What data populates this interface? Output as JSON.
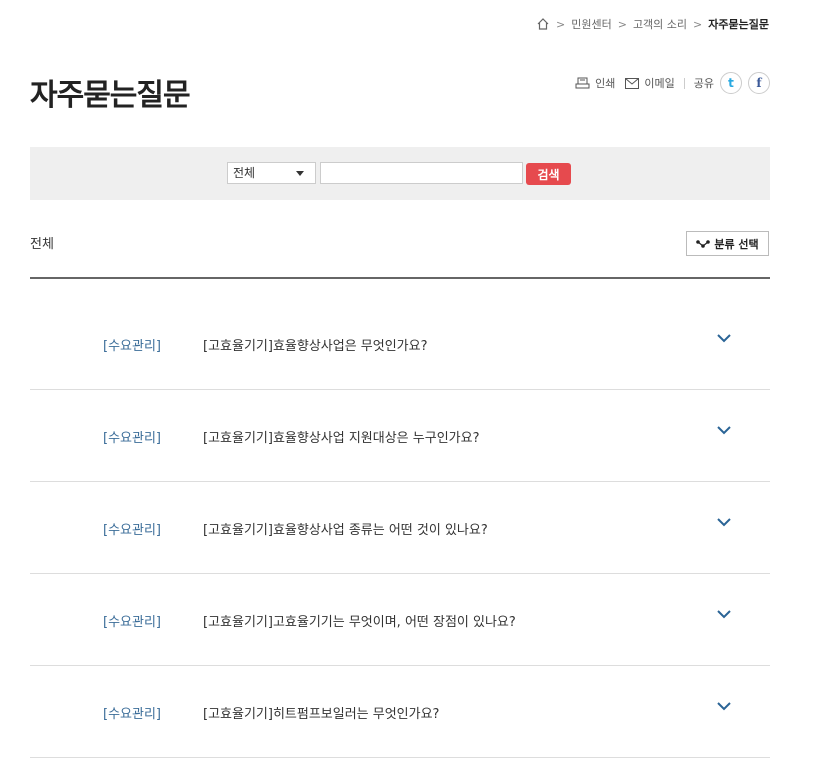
{
  "breadcrumb": {
    "items": [
      "민원센터",
      "고객의 소리"
    ],
    "current": "자주묻는질문"
  },
  "title": "자주묻는질문",
  "utils": {
    "print": "인쇄",
    "email": "이메일",
    "share": "공유",
    "twitter": "t",
    "facebook": "f"
  },
  "search": {
    "select_value": "전체",
    "input_value": "",
    "button": "검색"
  },
  "category": {
    "current": "전체",
    "select_button": "분류 선택"
  },
  "faq": [
    {
      "category": "[수요관리]",
      "question": "[고효율기기]효율향상사업은 무엇인가요?"
    },
    {
      "category": "[수요관리]",
      "question": "[고효율기기]효율향상사업 지원대상은 누구인가요?"
    },
    {
      "category": "[수요관리]",
      "question": "[고효율기기]효율향상사업 종류는 어떤 것이 있나요?"
    },
    {
      "category": "[수요관리]",
      "question": "[고효율기기]고효율기기는 무엇이며, 어떤 장점이 있나요?"
    },
    {
      "category": "[수요관리]",
      "question": "[고효율기기]히트펌프보일러는 무엇인가요?"
    }
  ],
  "colors": {
    "accent": "#e64a4e",
    "category_text": "#3b6d99",
    "chevron": "#2a6496"
  }
}
